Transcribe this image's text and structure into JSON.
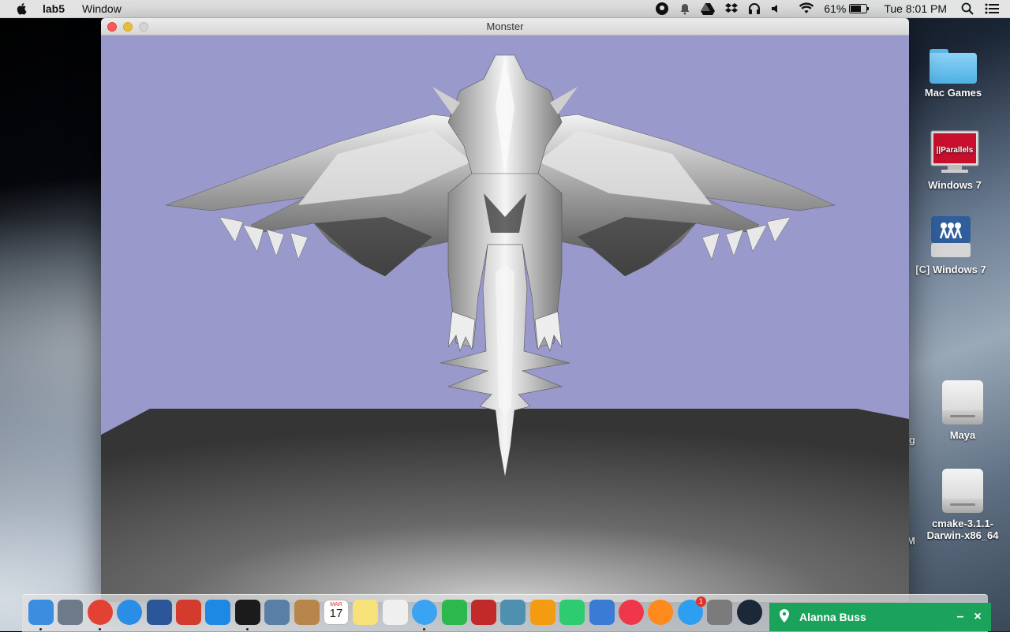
{
  "menubar": {
    "app_name": "lab5",
    "menus": [
      "Window"
    ],
    "battery_percent": "61%",
    "clock": "Tue 8:01 PM"
  },
  "window": {
    "title": "Monster",
    "sky_color": "#9a99cc",
    "floor_color": "#4a4a4a"
  },
  "desktop": {
    "icons": [
      {
        "label": "Mac Games",
        "icon": "folder-icon"
      },
      {
        "label": "Windows 7",
        "icon": "parallels-vm-icon",
        "badge": "||Parallels"
      },
      {
        "label": "[C] Windows 7",
        "icon": "network-share-icon"
      },
      {
        "label": "Maya",
        "icon": "drive-icon"
      },
      {
        "label": "cmake-3.1.1-Darwin-x86_64",
        "icon": "drive-icon"
      }
    ],
    "partial_labels": [
      "g",
      "M"
    ]
  },
  "dock": {
    "apps": [
      {
        "name": "finder",
        "color": "#3b8de0"
      },
      {
        "name": "launchpad",
        "color": "#6c7a89"
      },
      {
        "name": "chrome",
        "color": "#e34133"
      },
      {
        "name": "safari",
        "color": "#2a8de6"
      },
      {
        "name": "word",
        "color": "#2b579a"
      },
      {
        "name": "autodesk",
        "color": "#d33b2c"
      },
      {
        "name": "xcode",
        "color": "#1e88e5"
      },
      {
        "name": "terminal",
        "color": "#1b1b1b"
      },
      {
        "name": "preview",
        "color": "#5a7fa6"
      },
      {
        "name": "contacts",
        "color": "#b8864a"
      },
      {
        "name": "calendar",
        "color": "#ffffff"
      },
      {
        "name": "notes",
        "color": "#f7e27a"
      },
      {
        "name": "reminders",
        "color": "#efefef"
      },
      {
        "name": "messages",
        "color": "#3aa3f2"
      },
      {
        "name": "facetime",
        "color": "#2db84d"
      },
      {
        "name": "photo-booth",
        "color": "#c22a2a"
      },
      {
        "name": "iphoto",
        "color": "#4f8fb0"
      },
      {
        "name": "pages",
        "color": "#f39c12"
      },
      {
        "name": "numbers",
        "color": "#2ecc71"
      },
      {
        "name": "keynote",
        "color": "#3a7bd5"
      },
      {
        "name": "itunes",
        "color": "#f0364a"
      },
      {
        "name": "ibooks",
        "color": "#ff8a1c"
      },
      {
        "name": "app-store",
        "color": "#2d9ff0"
      },
      {
        "name": "system-preferences",
        "color": "#7b7b7b"
      },
      {
        "name": "steam",
        "color": "#1b2838"
      }
    ],
    "calendar_month": "MAR",
    "calendar_day": "17",
    "appstore_badge": "1"
  },
  "notification": {
    "name": "Alanna Buss",
    "minimize": "–",
    "close": "×"
  }
}
